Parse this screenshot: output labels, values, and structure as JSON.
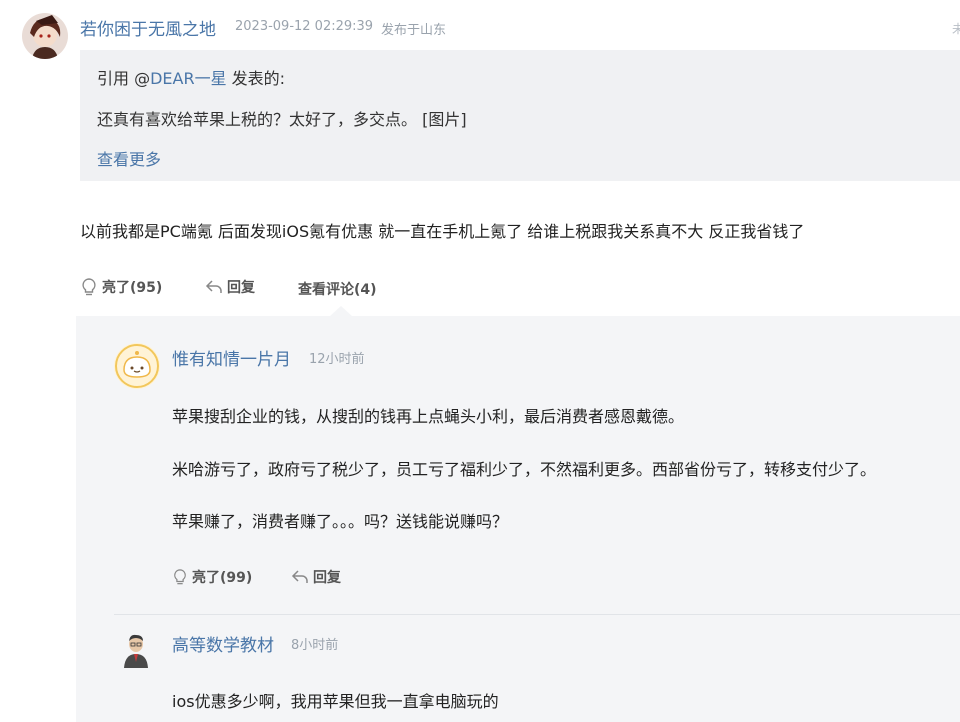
{
  "main_post": {
    "username": "若你困于无風之地",
    "timestamp": "2023-09-12 02:29:39",
    "location": "发布于山东",
    "corner_mark": "未",
    "quote": {
      "prefix": "引用 @",
      "quoted_user": "DEAR一星",
      "suffix": " 发表的:",
      "text": "还真有喜欢给苹果上税的？太好了，多交点。 [图片]",
      "more_label": "查看更多"
    },
    "content": "以前我都是PC端氪 后面发现iOS氪有优惠 就一直在手机上氪了 给谁上税跟我关系真不大 反正我省钱了",
    "actions": {
      "like_label": "亮了(95)",
      "reply_label": "回复",
      "view_comments_label": "查看评论(4)"
    }
  },
  "replies": [
    {
      "username": "惟有知情一片月",
      "time": "12小时前",
      "paragraphs": [
        "苹果搜刮企业的钱，从搜刮的钱再上点蝇头小利，最后消费者感恩戴德。",
        "米哈游亏了，政府亏了税少了，员工亏了福利少了，不然福利更多。西部省份亏了，转移支付少了。",
        "苹果赚了，消费者赚了。。。吗？送钱能说赚吗？"
      ],
      "like_label": "亮了(99)",
      "reply_label": "回复"
    },
    {
      "username": "高等数学教材",
      "time": "8小时前",
      "paragraphs": [
        "ios优惠多少啊，我用苹果但我一直拿电脑玩的"
      ]
    }
  ],
  "colors": {
    "link": "#4a76a8",
    "muted": "#9aa3ad",
    "quote_bg": "#f0f1f3",
    "panel_bg": "#f4f5f7"
  }
}
